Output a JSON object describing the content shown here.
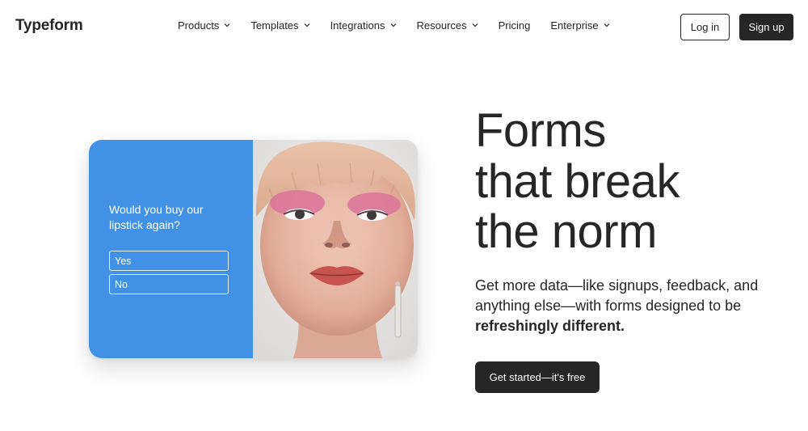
{
  "brand": {
    "logo_text": "Typeform"
  },
  "nav": {
    "items": [
      {
        "label": "Products",
        "has_dropdown": true
      },
      {
        "label": "Templates",
        "has_dropdown": true
      },
      {
        "label": "Integrations",
        "has_dropdown": true
      },
      {
        "label": "Resources",
        "has_dropdown": true
      },
      {
        "label": "Pricing",
        "has_dropdown": false
      },
      {
        "label": "Enterprise",
        "has_dropdown": true
      }
    ],
    "login_label": "Log in",
    "signup_label": "Sign up"
  },
  "card": {
    "question": "Would you buy our lipstick again?",
    "choices": [
      "Yes",
      "No"
    ],
    "accent_color": "#4191e6",
    "image_icon": "portrait-photo"
  },
  "hero": {
    "title_lines": [
      "Forms",
      "that break",
      "the norm"
    ],
    "subtitle_text": "Get more data—like signups, feedback, and anything else—with forms designed to be ",
    "subtitle_bold": "refreshingly different.",
    "cta_label": "Get started—it's free"
  },
  "colors": {
    "dark": "#262627",
    "background": "#ffffff"
  }
}
